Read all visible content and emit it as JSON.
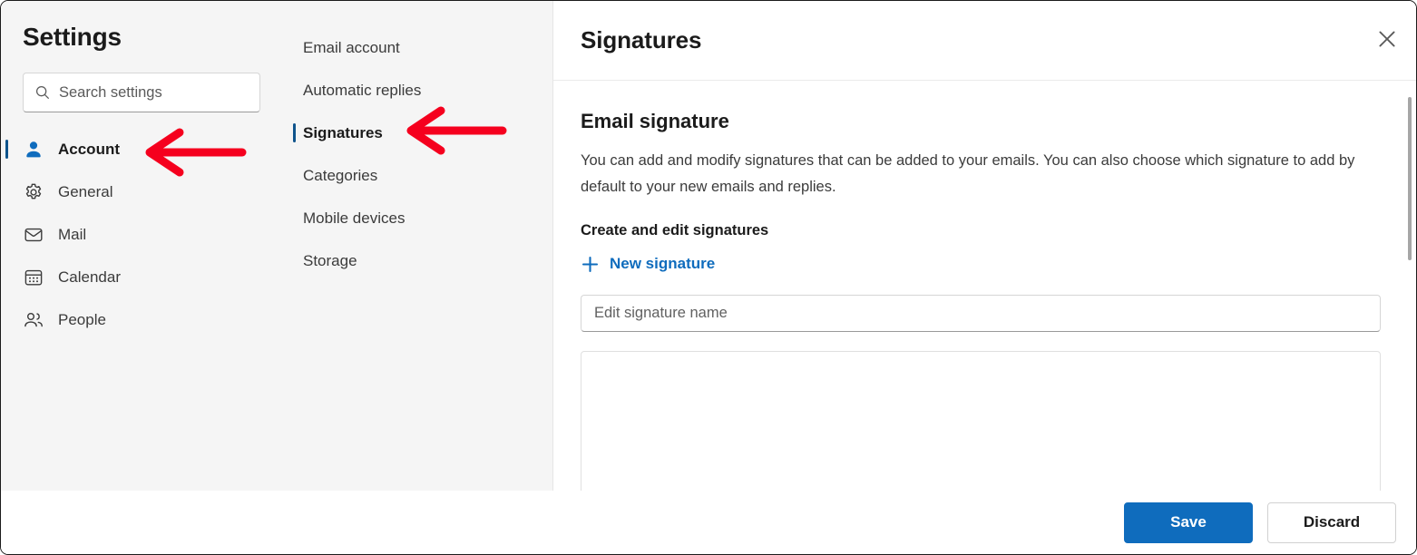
{
  "window": {
    "accent_color": "#0f6cbd",
    "selected_indicator_color": "#0f548c",
    "annotation_color": "#f5001e",
    "sidebar_bg": "#f5f5f5"
  },
  "sidebar": {
    "title": "Settings",
    "search": {
      "icon": "search-icon",
      "placeholder": "Search settings",
      "value": ""
    },
    "items": [
      {
        "label": "Account",
        "icon": "person-icon",
        "selected": true
      },
      {
        "label": "General",
        "icon": "gear-icon",
        "selected": false
      },
      {
        "label": "Mail",
        "icon": "envelope-icon",
        "selected": false
      },
      {
        "label": "Calendar",
        "icon": "calendar-icon",
        "selected": false
      },
      {
        "label": "People",
        "icon": "people-icon",
        "selected": false
      }
    ]
  },
  "subnav": {
    "items": [
      {
        "label": "Email account",
        "selected": false
      },
      {
        "label": "Automatic replies",
        "selected": false
      },
      {
        "label": "Signatures",
        "selected": true
      },
      {
        "label": "Categories",
        "selected": false
      },
      {
        "label": "Mobile devices",
        "selected": false
      },
      {
        "label": "Storage",
        "selected": false
      }
    ]
  },
  "main": {
    "title": "Signatures",
    "close_icon": "close-icon",
    "section_title": "Email signature",
    "description": "You can add and modify signatures that can be added to your emails. You can also choose which signature to add by default to your new emails and replies.",
    "subsection_title": "Create and edit signatures",
    "new_signature": {
      "icon": "plus-icon",
      "label": "New signature"
    },
    "signature_name": {
      "placeholder": "Edit signature name",
      "value": ""
    },
    "signature_editor": {
      "value": ""
    },
    "scrollbar": "vertical-scrollbar"
  },
  "footer": {
    "save_label": "Save",
    "discard_label": "Discard"
  },
  "annotations": [
    {
      "name": "arrow-pointing-to-account",
      "target": "Account",
      "color": "#f5001e"
    },
    {
      "name": "arrow-pointing-to-signatures",
      "target": "Signatures",
      "color": "#f5001e"
    }
  ]
}
